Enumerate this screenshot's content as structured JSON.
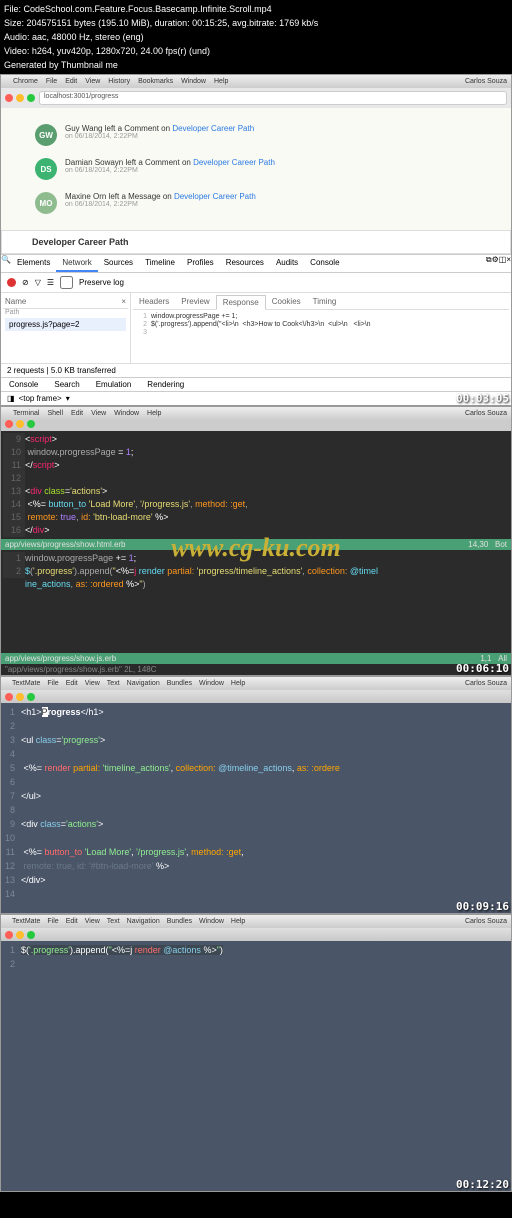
{
  "header": {
    "file": "File: CodeSchool.com.Feature.Focus.Basecamp.Infinite.Scroll.mp4",
    "size": "Size: 204575151 bytes (195.10 MiB), duration: 00:15:25, avg.bitrate: 1769 kb/s",
    "audio": "Audio: aac, 48000 Hz, stereo (eng)",
    "video": "Video: h264, yuv420p, 1280x720, 24.00 fps(r) (und)",
    "generated": "Generated by Thumbnail me"
  },
  "macmenu": {
    "apple": "",
    "items": [
      "Chrome",
      "File",
      "Edit",
      "View",
      "History",
      "Bookmarks",
      "Window",
      "Help"
    ],
    "right": "Carlos Souza"
  },
  "chrome": {
    "url": "localhost:3001/progress"
  },
  "feed": {
    "items": [
      {
        "avatar": "GW",
        "color": "#5a9e6f",
        "text": "Guy Wang left a Comment on",
        "link": "Developer Career Path",
        "date": "on 06/18/2014, 2:22PM"
      },
      {
        "avatar": "DS",
        "color": "#3cb371",
        "text": "Damian Sowayn left a Comment on",
        "link": "Developer Career Path",
        "date": "on 06/18/2014, 2:22PM"
      },
      {
        "avatar": "MO",
        "color": "#8fbc8f",
        "text": "Maxine Orn left a Message on",
        "link": "Developer Career Path",
        "date": "on 06/18/2014, 2:22PM"
      }
    ],
    "pathTitle": "Developer Career Path"
  },
  "devtools": {
    "searchIcon": "🔍",
    "tabs": [
      "Elements",
      "Network",
      "Sources",
      "Timeline",
      "Profiles",
      "Resources",
      "Audits",
      "Console"
    ],
    "activeTab": "Network",
    "preserveLog": "Preserve log",
    "leftHeader": {
      "name": "Name",
      "path": "Path",
      "close": "×"
    },
    "file": "progress.js?page=2",
    "subtabs": [
      "Headers",
      "Preview",
      "Response",
      "Cookies",
      "Timing"
    ],
    "activeSubtab": "Response",
    "code": {
      "l1": "window.progressPage += 1;",
      "l2": "$('.progress').append(\"<li>\\n  <h3>How to Cook<\\/h3>\\n  <ul>\\n   <li>\\n"
    },
    "status": "2 requests | 5.0 KB transferred",
    "bottomTabs": [
      "Console",
      "Search",
      "Emulation",
      "Rendering"
    ],
    "frame": "<top frame>"
  },
  "timestamps": {
    "t1": "00:03:05",
    "t2": "00:06:10",
    "t3": "00:09:16",
    "t4": "00:12:20"
  },
  "termMenu": [
    "Terminal",
    "Shell",
    "Edit",
    "View",
    "Window",
    "Help"
  ],
  "vim1": {
    "lines": [
      {
        "n": "9",
        "html": "<span class='kw-white'>&lt;</span><span class='kw-pink'>script</span><span class='kw-white'>&gt;</span>"
      },
      {
        "n": "10",
        "html": "  window<span class='kw-white'>.</span>progressPage <span class='kw-white'>=</span> <span class='kw-purple'>1</span><span class='kw-white'>;</span>"
      },
      {
        "n": "11",
        "html": "<span class='kw-white'>&lt;/</span><span class='kw-pink'>script</span><span class='kw-white'>&gt;</span>"
      },
      {
        "n": "12",
        "html": ""
      },
      {
        "n": "13",
        "html": "<span class='kw-white'>&lt;</span><span class='kw-pink'>div</span> <span class='kw-green'>class</span><span class='kw-white'>=</span><span class='kw-yellow'>'actions'</span><span class='kw-white'>&gt;</span>"
      },
      {
        "n": "14",
        "html": "  <span class='kw-white'>&lt;%=</span> <span class='kw-blue'>button_to</span> <span class='kw-yellow'>'Load More'</span>, <span class='kw-yellow'>'/progress.js'</span>, <span class='kw-orange'>method:</span> <span class='kw-orange'>:get</span>,"
      },
      {
        "n": "15",
        "html": "    <span class='kw-orange'>remote:</span> <span class='kw-purple'>true</span>, <span class='kw-orange'>id:</span> <span class='kw-yellow'>'btn-load-more'</span> <span class='kw-white'>%&gt;</span>"
      },
      {
        "n": "16",
        "html": "<span class='kw-white'>&lt;/</span><span class='kw-pink'>div</span><span class='kw-white'>&gt;</span>"
      }
    ],
    "status1": {
      "file": "app/views/progress/show.html.erb",
      "pos": "14,30",
      "mode": "Bot"
    },
    "lines2": [
      {
        "n": "1",
        "html": "window<span class='kw-white'>.</span>progressPage <span class='kw-white'>+=</span> <span class='kw-purple'>1</span><span class='kw-white'>;</span>"
      },
      {
        "n": "2",
        "html": "<span class='kw-blue'>$</span>(<span class='kw-yellow'>'.progress'</span>).append(<span class='kw-yellow'>\"</span><span class='kw-white'>&lt;%=</span><span class='kw-pink'>j</span> <span class='kw-blue'>render</span> <span class='kw-orange'>partial:</span> <span class='kw-yellow'>'progress/timeline_actions'</span>, <span class='kw-orange'>collection:</span> <span class='kw-blue'>@timel</span>"
      },
      {
        "n": "",
        "html": "<span class='kw-blue'>ine_actions</span>, <span class='kw-orange'>as:</span> <span class='kw-orange'>:ordered</span> <span class='kw-white'>%&gt;</span><span class='kw-yellow'>\"</span>)"
      }
    ],
    "status2": {
      "file": "app/views/progress/show.js.erb",
      "pos": "1,1",
      "mode": "All"
    },
    "cmdline": "\"app/views/progress/show.js.erb\" 2L, 148C"
  },
  "watermark": "www.cg-ku.com",
  "tmMenu": [
    "TextMate",
    "File",
    "Edit",
    "View",
    "Text",
    "Navigation",
    "Bundles",
    "Window",
    "Help"
  ],
  "tm1": {
    "lines": [
      {
        "n": "1",
        "html": "<span class='tm-white'>&lt;h1&gt;</span><span class='tm-cursor'>P</span><span class='tm-bold-white'>rogress</span><span class='tm-white'>&lt;/h1&gt;</span>"
      },
      {
        "n": "2",
        "html": ""
      },
      {
        "n": "3",
        "html": "<span class='tm-white'>&lt;ul </span><span class='tm-blue'>class</span><span class='tm-white'>=</span><span class='tm-green'>'progress'</span><span class='tm-white'>&gt;</span>"
      },
      {
        "n": "4",
        "html": ""
      },
      {
        "n": "5",
        "html": "  <span class='tm-white'>&lt;%=</span> <span class='tm-red'>render</span> <span class='tm-orange'>partial:</span> <span class='tm-green'>'timeline_actions'</span>, <span class='tm-orange'>collection:</span> <span class='tm-blue'>@timeline_actions</span>, <span class='tm-orange'>as:</span> <span class='tm-orange'>:ordere</span>"
      },
      {
        "n": "6",
        "html": ""
      },
      {
        "n": "7",
        "html": "<span class='tm-white'>&lt;/ul&gt;</span>"
      },
      {
        "n": "8",
        "html": ""
      },
      {
        "n": "9",
        "html": "<span class='tm-white'>&lt;div </span><span class='tm-blue'>class</span><span class='tm-white'>=</span><span class='tm-green'>'actions'</span><span class='tm-white'>&gt;</span>"
      },
      {
        "n": "10",
        "html": ""
      },
      {
        "n": "11",
        "html": "  <span class='tm-white'>&lt;%=</span> <span class='tm-red'>button_to</span> <span class='tm-green'>'Load More'</span>, <span class='tm-green'>'/progress.js'</span>, <span class='tm-orange'>method:</span> <span class='tm-orange'>:get</span>,"
      },
      {
        "n": "12",
        "html": "    <span class='tm-comment'>remote: true, id: '#btn-load-more'</span> <span class='tm-white'>%&gt;</span>"
      },
      {
        "n": "13",
        "html": "<span class='tm-white'>&lt;/div&gt;</span>"
      },
      {
        "n": "14",
        "html": ""
      }
    ]
  },
  "tm2": {
    "lines": [
      {
        "n": "1",
        "html": "<span class='tm-highlight'><span class='tm-white'>$(</span><span class='tm-green'>'.progress'</span><span class='tm-white'>).append(</span><span class='tm-green'>\"</span><span class='tm-white'>&lt;%=j</span> <span class='tm-red'>render</span> <span class='tm-blue'>@actions</span> <span class='tm-white'>%&gt;</span><span class='tm-green'>\"</span><span class='tm-white'>)</span></span>"
      },
      {
        "n": "2",
        "html": ""
      }
    ]
  }
}
